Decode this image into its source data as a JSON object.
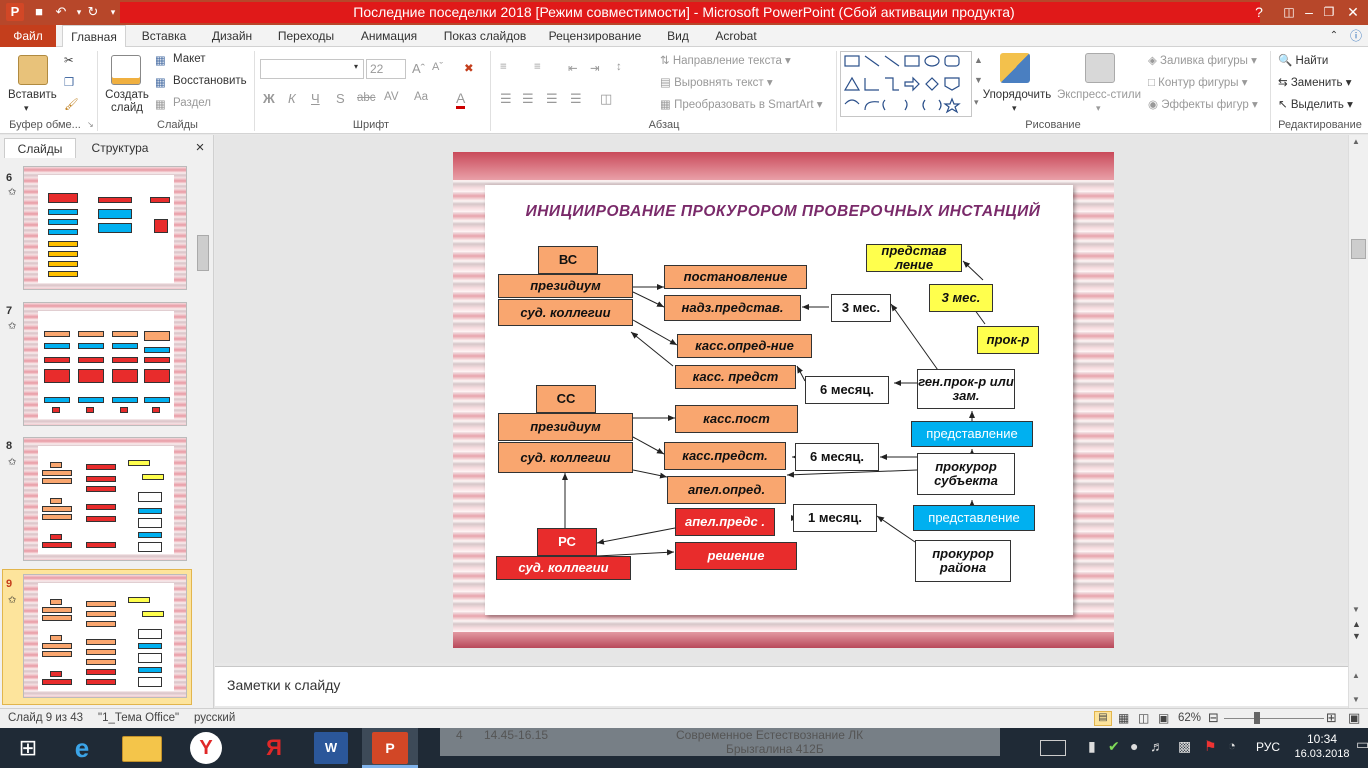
{
  "titlebar": {
    "title": "Последние поседелки 2018 [Режим совместимости] - Microsoft PowerPoint (Сбой активации продукта)",
    "qat_icons": [
      "powerpoint-logo-icon",
      "save-icon",
      "undo-icon",
      "redo-icon",
      "customize-qat-icon"
    ],
    "window_buttons": [
      "help-icon",
      "restore-ribbon-icon",
      "minimize-icon",
      "maximize-icon",
      "close-icon"
    ],
    "help": "?",
    "minimize": "–",
    "maximize": "❐",
    "close": "✕"
  },
  "tabs": {
    "file": "Файл",
    "items": [
      "Главная",
      "Вставка",
      "Дизайн",
      "Переходы",
      "Анимация",
      "Показ слайдов",
      "Рецензирование",
      "Вид",
      "Acrobat"
    ],
    "active": "Главная"
  },
  "ribbon": {
    "clipboard": {
      "paste": "Вставить",
      "label": "Буфер обме..."
    },
    "slides": {
      "new_slide": "Создать слайд",
      "layout": "Макет",
      "reset": "Восстановить",
      "section": "Раздел",
      "label": "Слайды"
    },
    "font": {
      "font_name": "",
      "font_size": "22",
      "bold": "Ж",
      "italic": "К",
      "underline": "Ч",
      "strike": "S",
      "abc": "abc",
      "spacing": "AV",
      "case": "Aa",
      "color": "A",
      "label": "Шрифт"
    },
    "paragraph": {
      "text_direction": "Направление текста",
      "align_text": "Выровнять текст",
      "smartart": "Преобразовать в SmartArt",
      "label": "Абзац"
    },
    "drawing": {
      "arrange": "Упорядочить",
      "quick_styles": "Экспресс-стили",
      "fill": "Заливка фигуры",
      "outline": "Контур фигуры",
      "effects": "Эффекты фигур",
      "label": "Рисование"
    },
    "editing": {
      "find": "Найти",
      "replace": "Заменить",
      "select": "Выделить",
      "label": "Редактирование"
    },
    "accent": "#c43e1c"
  },
  "left_panel": {
    "tabs": [
      "Слайды",
      "Структура"
    ],
    "close": "×",
    "slides": [
      {
        "number": "6"
      },
      {
        "number": "7"
      },
      {
        "number": "8"
      },
      {
        "number": "9",
        "selected": true
      }
    ]
  },
  "slide": {
    "title": "ИНИЦИИРОВАНИЕ   ПРОКУРОРОМ  ПРОВЕРОЧНЫХ ИНСТАНЦИЙ",
    "boxes": {
      "vs": "ВС",
      "vs_presidium": "президиум",
      "vs_sud": "суд. коллегии",
      "postanovlenie": "постановление",
      "nadz_predstav": "надз.представ.",
      "kass_opred": "касс.опред-ние",
      "kass_predst": "касс.  предст",
      "three_mes_1": "3 мес.",
      "predstavlenie_y": "представ ление",
      "three_mes_2": "3 мес.",
      "prok_r": "прок-р",
      "six_mes_1": "6 месяц.",
      "gen_prok": "ген.прок-р или зам.",
      "predstavlenie_b1": "представление",
      "ss": "СС",
      "ss_presidium": "президиум",
      "ss_sud": "суд. коллегии",
      "kass_post": "касс.пост",
      "kass_predst_2": "касс.предст.",
      "six_mes_2": "6 месяц.",
      "prok_subj": "прокурор субъекта",
      "apel_opred": "апел.опред.",
      "predstavlenie_b2": "представление",
      "apel_preds": "апел.предс .",
      "one_mes": "1 месяц.",
      "rs": "РС",
      "rs_sud": "суд. коллегии",
      "reshenie": "решение",
      "prok_rayon": "прокурор района"
    },
    "colors": {
      "orange": "#f9a66f",
      "red": "#e82c2c",
      "yellow": "#ffff4d",
      "blue": "#00b0f0",
      "title": "#7a2a6a"
    }
  },
  "notes": {
    "placeholder": "Заметки к слайду"
  },
  "status": {
    "slide_info": "Слайд 9 из 43",
    "theme": "\"1_Тема Office\"",
    "lang": "русский",
    "zoom": "62%",
    "zoom_fraction": 0.62
  },
  "taskbar": {
    "apps": [
      "start-windows-icon",
      "internet-explorer-icon",
      "file-explorer-icon",
      "yandex-browser-icon",
      "yandex-icon",
      "word-icon",
      "powerpoint-icon"
    ],
    "bg_text_1": "14.45-16.15",
    "bg_text_2": "Современное Естествознание ЛК",
    "bg_text_3": "Брызгалина 412Б",
    "bg_num": "4",
    "lang": "РУС",
    "time": "10:34",
    "date": "16.03.2018"
  }
}
